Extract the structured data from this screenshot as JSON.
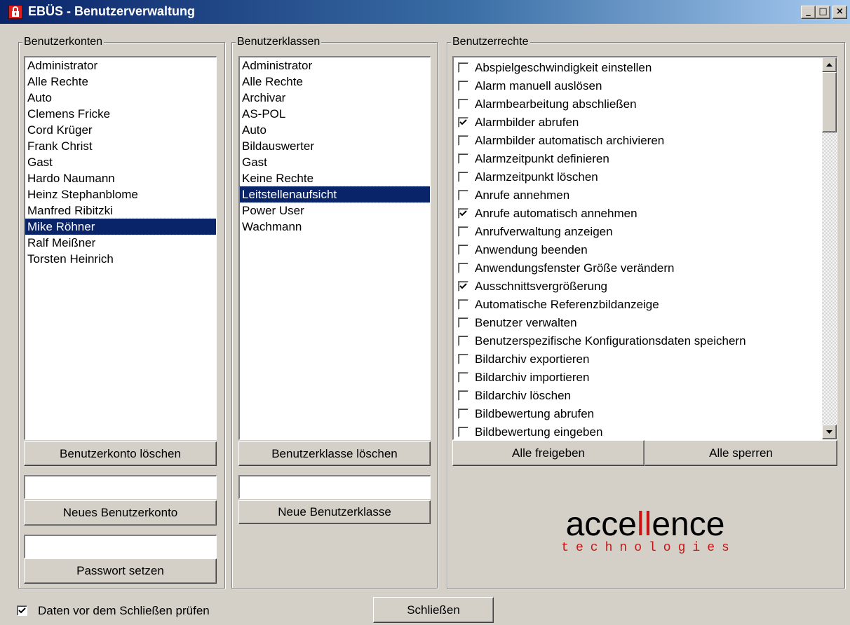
{
  "window": {
    "title": "EBÜS - Benutzerverwaltung",
    "controls": {
      "minimize": "_",
      "maximize": "□",
      "close": "×"
    }
  },
  "accounts": {
    "group_label": "Benutzerkonten",
    "items": [
      "Administrator",
      "Alle Rechte",
      "Auto",
      "Clemens Fricke",
      "Cord Krüger",
      "Frank Christ",
      "Gast",
      "Hardo Naumann",
      "Heinz Stephanblome",
      "Manfred Ribitzki",
      "Mike Röhner",
      "Ralf Meißner",
      "Torsten Heinrich"
    ],
    "selected": "Mike Röhner",
    "delete_label": "Benutzerkonto löschen",
    "new_input_value": "",
    "new_label": "Neues Benutzerkonto",
    "password_input_value": "",
    "password_label": "Passwort setzen"
  },
  "classes": {
    "group_label": "Benutzerklassen",
    "items": [
      "Administrator",
      "Alle Rechte",
      "Archivar",
      "AS-POL",
      "Auto",
      "Bildauswerter",
      "Gast",
      "Keine Rechte",
      "Leitstellenaufsicht",
      "Power User",
      "Wachmann"
    ],
    "selected": "Leitstellenaufsicht",
    "delete_label": "Benutzerklasse löschen",
    "new_input_value": "",
    "new_label": "Neue Benutzerklasse"
  },
  "rights": {
    "group_label": "Benutzerrechte",
    "items": [
      {
        "label": "Abspielgeschwindigkeit einstellen",
        "checked": false
      },
      {
        "label": "Alarm manuell auslösen",
        "checked": false
      },
      {
        "label": "Alarmbearbeitung abschließen",
        "checked": false
      },
      {
        "label": "Alarmbilder abrufen",
        "checked": true
      },
      {
        "label": "Alarmbilder automatisch archivieren",
        "checked": false
      },
      {
        "label": "Alarmzeitpunkt definieren",
        "checked": false
      },
      {
        "label": "Alarmzeitpunkt löschen",
        "checked": false
      },
      {
        "label": "Anrufe annehmen",
        "checked": false
      },
      {
        "label": "Anrufe automatisch annehmen",
        "checked": true
      },
      {
        "label": "Anrufverwaltung anzeigen",
        "checked": false
      },
      {
        "label": "Anwendung beenden",
        "checked": false
      },
      {
        "label": "Anwendungsfenster Größe verändern",
        "checked": false
      },
      {
        "label": "Ausschnittsvergrößerung",
        "checked": true
      },
      {
        "label": "Automatische Referenzbildanzeige",
        "checked": false
      },
      {
        "label": "Benutzer verwalten",
        "checked": false
      },
      {
        "label": "Benutzerspezifische Konfigurationsdaten speichern",
        "checked": false
      },
      {
        "label": "Bildarchiv exportieren",
        "checked": false
      },
      {
        "label": "Bildarchiv importieren",
        "checked": false
      },
      {
        "label": "Bildarchiv löschen",
        "checked": false
      },
      {
        "label": "Bildbewertung abrufen",
        "checked": false
      },
      {
        "label": "Bildbewertung eingeben",
        "checked": false
      }
    ],
    "enable_all_label": "Alle freigeben",
    "disable_all_label": "Alle sperren"
  },
  "logo": {
    "part1": "acce",
    "part2": "ll",
    "part3": "ence",
    "sub": "technologies",
    "brand_red": "#c81414"
  },
  "footer": {
    "check_label": "Daten vor dem Schließen prüfen",
    "check_checked": true,
    "close_label": "Schließen"
  },
  "colors": {
    "face": "#d4d0c8",
    "selection": "#0a246a",
    "title_start": "#0a246a",
    "title_end": "#a6caf0"
  }
}
